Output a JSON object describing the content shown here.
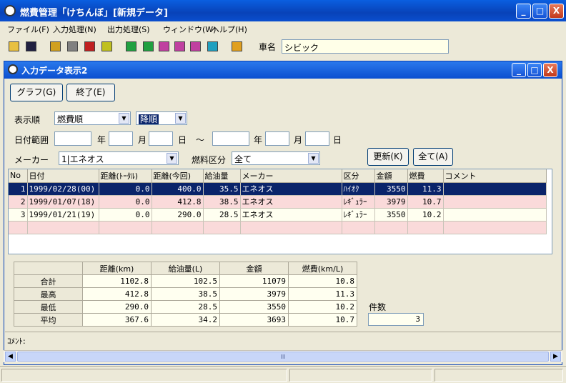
{
  "app": {
    "title": "燃費管理「けちんぼ」[新規データ]",
    "window_controls": {
      "minimize": "_",
      "maximize": "□",
      "close": "X"
    }
  },
  "menu": [
    {
      "label": "ファイル(F)"
    },
    {
      "label": "入力処理(N)"
    },
    {
      "label": "出力処理(S)"
    },
    {
      "label": "ウィンドウ(W)"
    },
    {
      "label": "ヘルプ(H)"
    }
  ],
  "toolbar": {
    "icons": [
      "open-icon",
      "save-icon",
      "tool-icon-1",
      "tool-icon-2",
      "tool-icon-3",
      "tool-icon-4",
      "tool-icon-5",
      "tool-icon-6",
      "tool-icon-7",
      "tool-icon-8",
      "tool-icon-9",
      "tool-icon-10",
      "tool-icon-11"
    ],
    "car_label": "車名",
    "car_value": "シビック"
  },
  "child": {
    "title": "入力データ表示2",
    "graph_button": "グラフ(G)",
    "exit_button": "終了(E)",
    "sort_label": "表示順",
    "sort_value": "燃費順",
    "order_value": "降順",
    "date_label": "日付範囲",
    "year": "年",
    "month": "月",
    "day": "日",
    "tilde": "～",
    "maker_label": "メーカー",
    "maker_value": "1|エネオス",
    "fuel_label": "燃料区分",
    "fuel_value": "全て",
    "update_button": "更新(K)",
    "all_button": "全て(A)",
    "columns": [
      "No",
      "日付",
      "距離(ﾄｰﾀﾙ)",
      "距離(今回)",
      "給油量",
      "メーカー",
      "区分",
      "金額",
      "燃費",
      "コメント"
    ],
    "rows": [
      {
        "no": "1",
        "date": "1999/02/28(00)",
        "total": "0.0",
        "dist": "400.0",
        "fuel": "35.5",
        "maker": "エネオス",
        "kind": "ﾊｲｵｸ",
        "price": "3550",
        "eff": "11.3",
        "comment": ""
      },
      {
        "no": "2",
        "date": "1999/01/07(18)",
        "total": "0.0",
        "dist": "412.8",
        "fuel": "38.5",
        "maker": "エネオス",
        "kind": "ﾚｷﾞｭﾗｰ",
        "price": "3979",
        "eff": "10.7",
        "comment": ""
      },
      {
        "no": "3",
        "date": "1999/01/21(19)",
        "total": "0.0",
        "dist": "290.0",
        "fuel": "28.5",
        "maker": "エネオス",
        "kind": "ﾚｷﾞｭﾗｰ",
        "price": "3550",
        "eff": "10.2",
        "comment": ""
      }
    ],
    "summary": {
      "headers": [
        "距離(km)",
        "給油量(L)",
        "金額",
        "燃費(km/L)"
      ],
      "rows": [
        {
          "label": "合計",
          "values": [
            "1102.8",
            "102.5",
            "11079",
            "10.8"
          ]
        },
        {
          "label": "最高",
          "values": [
            "412.8",
            "38.5",
            "3979",
            "11.3"
          ]
        },
        {
          "label": "最低",
          "values": [
            "290.0",
            "28.5",
            "3550",
            "10.2"
          ]
        },
        {
          "label": "平均",
          "values": [
            "367.6",
            "34.2",
            "3693",
            "10.7"
          ]
        }
      ],
      "count_label": "件数",
      "count_value": "3"
    },
    "comment_label": "ｺﾒﾝﾄ:",
    "scroll_grip": "III"
  }
}
